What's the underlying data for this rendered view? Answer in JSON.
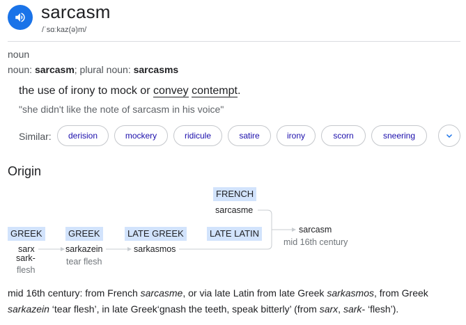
{
  "entry": {
    "word": "sarcasm",
    "phonetic": "/ˈsɑːkaz(ə)m/"
  },
  "sense": {
    "part_of_speech": "noun",
    "forms_prefix": "noun: ",
    "forms_word": "sarcasm",
    "forms_middle": "; plural noun: ",
    "forms_plural": "sarcasms",
    "definition_a": "the use of irony to mock or ",
    "definition_link1": "convey",
    "definition_space": " ",
    "definition_link2": "contempt",
    "definition_end": ".",
    "example": "\"she didn't like the note of sarcasm in his voice\""
  },
  "similar": {
    "label": "Similar:",
    "items": [
      "derision",
      "mockery",
      "ridicule",
      "satire",
      "irony",
      "scorn",
      "sneering"
    ]
  },
  "origin": {
    "title": "Origin",
    "nodes": {
      "greek1": {
        "lang": "GREEK",
        "term1": "sarx",
        "term2": "sark-",
        "gloss": "flesh"
      },
      "greek2": {
        "lang": "GREEK",
        "term": "sarkazein",
        "gloss": "tear flesh"
      },
      "lategreek": {
        "lang": "LATE GREEK",
        "term": "sarkasmos"
      },
      "latelatin": {
        "lang": "LATE LATIN"
      },
      "french": {
        "lang": "FRENCH",
        "term": "sarcasme"
      },
      "english": {
        "term": "sarcasm",
        "gloss": "mid 16th century"
      }
    },
    "etymology": {
      "p1": "mid 16th century: from French ",
      "i1": "sarcasme",
      "p2": ", or via late Latin from late Greek ",
      "i2": "sarkasmos",
      "p3": ", from Greek",
      "i3": "sarkazein",
      "p4": " ‘tear flesh’, in late Greek‘gnash the teeth, speak bitterly’ (from ",
      "i4": "sarx",
      "p5": ", ",
      "i5": "sark-",
      "p6": " ‘flesh’)."
    }
  },
  "colors": {
    "accent": "#1a73e8",
    "link": "#1a0dab",
    "lang_bg": "#d2e3fc"
  }
}
